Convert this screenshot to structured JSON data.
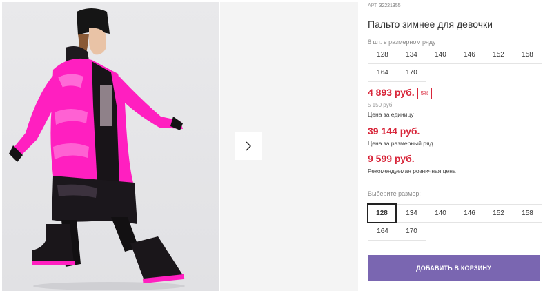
{
  "product": {
    "art_label": "АРТ.",
    "art_number": "32221355",
    "title": "Пальто зимнее для девочки",
    "pack_note": "8 шт. в размерном ряду",
    "pack_sizes": [
      "128",
      "134",
      "140",
      "146",
      "152",
      "158",
      "164",
      "170"
    ],
    "price_unit": "4 893 руб.",
    "discount_badge": "5%",
    "old_price": "5 150 руб.",
    "price_unit_caption": "Цена за единицу",
    "price_row": "39 144 руб.",
    "price_row_caption": "Цена за размерный ряд",
    "price_retail": "9 599 руб.",
    "price_retail_caption": "Рекомендуемая розничная цена",
    "choose_size_label": "Выберите размер:",
    "choose_sizes": [
      "128",
      "134",
      "140",
      "146",
      "152",
      "158",
      "164",
      "170"
    ],
    "selected_size": "128",
    "add_to_cart": "ДОБАВИТЬ В КОРЗИНУ"
  },
  "gallery": {
    "next_icon": "chevron-right-icon"
  },
  "colors": {
    "accent_red": "#d8263a",
    "button_purple": "#7a66b1",
    "jacket_pink": "#ff1fc0"
  }
}
